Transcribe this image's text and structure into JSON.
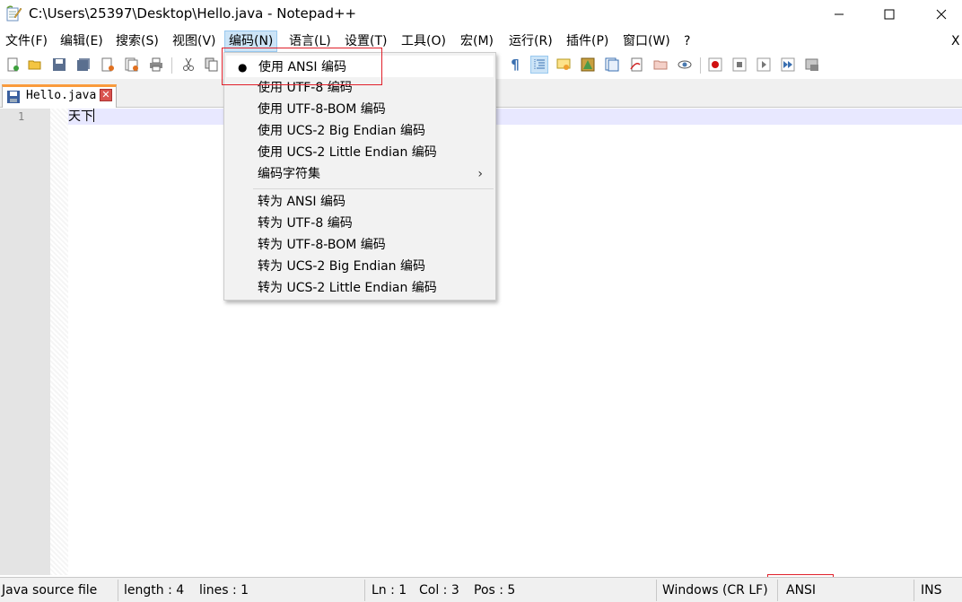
{
  "window": {
    "title": "C:\\Users\\25397\\Desktop\\Hello.java - Notepad++",
    "minimize_icon": "minimize-icon",
    "maximize_icon": "maximize-icon",
    "close_icon": "close-icon"
  },
  "menubar": {
    "items": [
      "文件(F)",
      "编辑(E)",
      "搜索(S)",
      "视图(V)",
      "编码(N)",
      "语言(L)",
      "设置(T)",
      "工具(O)",
      "宏(M)",
      "运行(R)",
      "插件(P)",
      "窗口(W)",
      "?"
    ],
    "active_index": 4,
    "close_doc": "X"
  },
  "tabs": [
    {
      "label": "Hello.java",
      "icon": "save-icon",
      "close_icon": "close-tab-icon"
    }
  ],
  "editor": {
    "line_numbers": [
      "1"
    ],
    "lines": [
      "天下"
    ]
  },
  "encoding_menu": {
    "group1": [
      {
        "label": "使用 ANSI 编码",
        "selected": true
      },
      {
        "label": "使用 UTF-8 编码",
        "selected": false
      },
      {
        "label": "使用 UTF-8-BOM 编码",
        "selected": false
      },
      {
        "label": "使用 UCS-2 Big Endian 编码",
        "selected": false
      },
      {
        "label": "使用 UCS-2 Little Endian 编码",
        "selected": false
      }
    ],
    "submenu": {
      "label": "编码字符集",
      "arrow": "›"
    },
    "group2": [
      {
        "label": "转为 ANSI 编码"
      },
      {
        "label": "转为 UTF-8 编码"
      },
      {
        "label": "转为 UTF-8-BOM 编码"
      },
      {
        "label": "转为 UCS-2 Big Endian 编码"
      },
      {
        "label": "转为 UCS-2 Little Endian 编码"
      }
    ],
    "bullet": "●"
  },
  "statusbar": {
    "file_type": "Java source file",
    "length": "length : 4",
    "lines": "lines : 1",
    "ln": "Ln : 1",
    "col": "Col : 3",
    "pos": "Pos : 5",
    "eol": "Windows (CR LF)",
    "encoding": "ANSI",
    "mode": "INS"
  },
  "colors": {
    "highlight_box": "#e0202a",
    "menu_active": "#cce4f7",
    "current_line": "#e8e8ff",
    "tab_accent": "#fa9b3c"
  }
}
